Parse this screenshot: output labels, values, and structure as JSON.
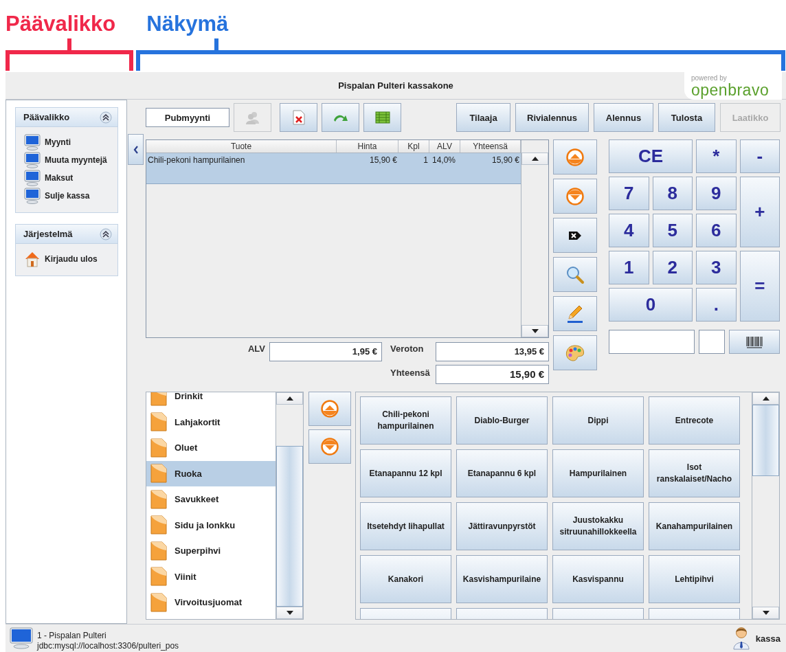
{
  "annotations": [
    {
      "label": "Päävalikko",
      "color": "#f0284a"
    },
    {
      "label": "Näkymä",
      "color": "#2673dd"
    }
  ],
  "window": {
    "title": "Pispalan Pulteri kassakone"
  },
  "logo": {
    "tagline": "powered by",
    "name": "openbravo"
  },
  "sidebar": {
    "panels": [
      {
        "title": "Päävalikko",
        "expanded": true,
        "items": [
          {
            "label": "Myynti",
            "kind": "monitor"
          },
          {
            "label": "Muuta myyntejä",
            "kind": "monitor"
          },
          {
            "label": "Maksut",
            "kind": "monitor"
          },
          {
            "label": "Sulje kassa",
            "kind": "monitor"
          }
        ]
      },
      {
        "title": "Järjestelmä",
        "expanded": true,
        "items": [
          {
            "label": "Kirjaudu ulos",
            "kind": "house"
          }
        ]
      }
    ]
  },
  "toolbar": {
    "ticket_name": "Pubmyynti",
    "icon_buttons": [
      {
        "kind": "customer",
        "disabled": true
      },
      {
        "kind": "delete",
        "disabled": false
      },
      {
        "kind": "forward",
        "disabled": false
      },
      {
        "kind": "grid",
        "disabled": false
      }
    ],
    "buttons": [
      {
        "label": "Tilaaja",
        "disabled": false
      },
      {
        "label": "Rivialennus",
        "disabled": false
      },
      {
        "label": "Alennus",
        "disabled": false
      },
      {
        "label": "Tulosta",
        "disabled": false
      },
      {
        "label": "Laatikko",
        "disabled": true
      }
    ]
  },
  "ticket": {
    "columns": [
      "Tuote",
      "Hinta",
      "Kpl",
      "ALV",
      "Yhteensä"
    ],
    "rows": [
      {
        "cells": [
          "Chili-pekoni hampurilainen",
          "15,90 €",
          "1",
          "14,0%",
          "15,90 €"
        ],
        "selected": true
      }
    ]
  },
  "totals": [
    {
      "label": "ALV",
      "value": "1,95 €"
    },
    {
      "label": "Veroton",
      "value": "13,95 €"
    },
    {
      "label": "Yhteensä",
      "value": "15,90 €"
    }
  ],
  "side_buttons": [
    {
      "kind": "up"
    },
    {
      "kind": "down"
    },
    {
      "kind": "backspace"
    },
    {
      "kind": "search"
    },
    {
      "kind": "edit"
    },
    {
      "kind": "palette"
    }
  ],
  "keypad": [
    {
      "label": "CE",
      "kind": "wide"
    },
    {
      "label": "*",
      "kind": "normal"
    },
    {
      "label": "-",
      "kind": "normal"
    },
    {
      "label": "7",
      "kind": "normal"
    },
    {
      "label": "8",
      "kind": "normal"
    },
    {
      "label": "9",
      "kind": "normal"
    },
    {
      "label": "+",
      "kind": "tall"
    },
    {
      "label": "4",
      "kind": "normal"
    },
    {
      "label": "5",
      "kind": "normal"
    },
    {
      "label": "6",
      "kind": "normal"
    },
    {
      "label": "1",
      "kind": "normal"
    },
    {
      "label": "2",
      "kind": "normal"
    },
    {
      "label": "3",
      "kind": "normal"
    },
    {
      "label": "=",
      "kind": "tall"
    },
    {
      "label": "0",
      "kind": "wide"
    },
    {
      "label": ".",
      "kind": "normal"
    }
  ],
  "categories": [
    {
      "label": "Drinkit",
      "selected": false
    },
    {
      "label": "Lahjakortit",
      "selected": false
    },
    {
      "label": "Oluet",
      "selected": false
    },
    {
      "label": "Ruoka",
      "selected": true
    },
    {
      "label": "Savukkeet",
      "selected": false
    },
    {
      "label": "Sidu ja lonkku",
      "selected": false
    },
    {
      "label": "Superpihvi",
      "selected": false
    },
    {
      "label": "Viinit",
      "selected": false
    },
    {
      "label": "Virvoitusjuomat",
      "selected": false
    }
  ],
  "products": [
    "Chili-pekoni hampurilainen",
    "Diablo-Burger",
    "Dippi",
    "Entrecote",
    "Etanapannu 12 kpl",
    "Etanapannu 6 kpl",
    "Hampurilainen",
    "Isot ranskalaiset/Nacho",
    "Itsetehdyt lihapullat",
    "Jättiravunpyrstöt",
    "Juustokakku sitruunahillokkeella",
    "Kanahampurilainen",
    "Kanakori",
    "Kasvishampurilaine",
    "Kasvispannu",
    "Lehtipihvi"
  ],
  "status_bar": {
    "connection": "1 - Pispalan Pulteri",
    "url": "jdbc:mysql://localhost:3306/pulteri_pos",
    "user": "kassa"
  }
}
